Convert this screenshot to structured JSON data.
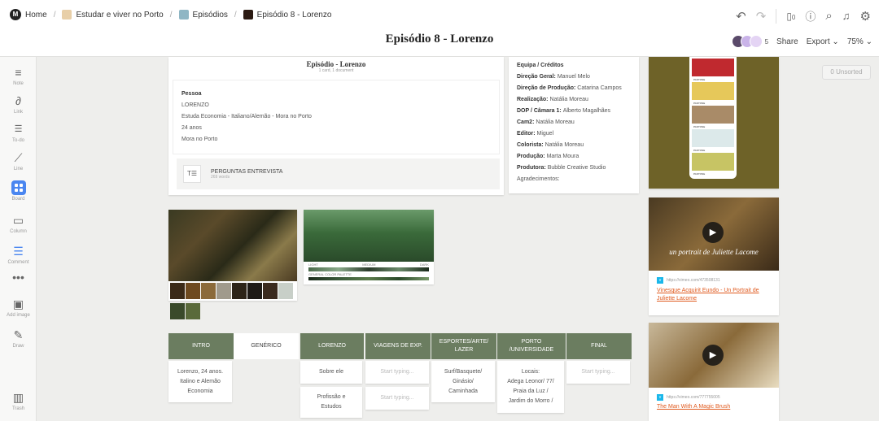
{
  "breadcrumbs": [
    {
      "label": "Home",
      "color": "#222222"
    },
    {
      "label": "Estudar e viver no Porto",
      "color": "#e8cfa8"
    },
    {
      "label": "Episódios",
      "color": "#8fb6c4"
    },
    {
      "label": "Episódio 8 - Lorenzo",
      "color": "#2b1a12"
    }
  ],
  "page_title": "Episódio 8 - Lorenzo",
  "toolbar": {
    "undo_icon": "undo-icon",
    "redo_icon": "redo-icon",
    "device_count": "0",
    "share_label": "Share",
    "export_label": "Export",
    "zoom_label": "75%",
    "avatar_count": "5"
  },
  "sidebar": [
    {
      "label": "Note",
      "icon": "note-icon"
    },
    {
      "label": "Link",
      "icon": "link-icon"
    },
    {
      "label": "To-do",
      "icon": "todo-icon"
    },
    {
      "label": "Line",
      "icon": "line-icon"
    },
    {
      "label": "Board",
      "icon": "board-icon"
    },
    {
      "label": "Column",
      "icon": "column-icon"
    },
    {
      "label": "Comment",
      "icon": "comment-icon"
    },
    {
      "label": "Add image",
      "icon": "image-icon"
    },
    {
      "label": "Draw",
      "icon": "draw-icon"
    },
    {
      "label": "Trash",
      "icon": "trash-icon"
    }
  ],
  "unsorted_label": "0 Unsorted",
  "board_card": {
    "title": "Episódio - Lorenzo",
    "meta": "1 card, 1 document",
    "note_lines": [
      "Pessoa",
      "LORENZO",
      "Estuda Economia - Italiano/Alemão - Mora no Porto",
      "24 anos",
      "Mora no Porto"
    ],
    "doc_title": "PERGUNTAS ENTREVISTA",
    "doc_meta": "269 words"
  },
  "credits": {
    "title": "Equipa / Créditos",
    "lines": [
      {
        "label": "Direção Geral:",
        "value": "Manuel Melo"
      },
      {
        "label": "Direção de Produção:",
        "value": "Catarina Campos"
      },
      {
        "label": "Realização:",
        "value": "Natália Moreau"
      },
      {
        "label": "DOP / Câmara 1:",
        "value": "Alberto Magalhães"
      },
      {
        "label": "Cam2:",
        "value": "Natália Moreau"
      },
      {
        "label": "Editor:",
        "value": "Miguel"
      },
      {
        "label": "Colorista:",
        "value": "Natália Moreau"
      },
      {
        "label": "Produção:",
        "value": "Marta Moura"
      },
      {
        "label": "Produtora:",
        "value": "Bubble Creative Studio"
      },
      {
        "label": "",
        "value": "Agradecimentos:"
      }
    ]
  },
  "palette_swatches": [
    "#3b2a18",
    "#6e4a20",
    "#8b6a3a",
    "#a09a8c",
    "#2d2418",
    "#1e1a16",
    "#3a2a1e",
    "#c8cfc8",
    "#3a4a2a",
    "#5a6a3a"
  ],
  "pantone_colors": [
    "#c0292f",
    "#e6c85a",
    "#a98b68",
    "#dce9ea",
    "#c7c464"
  ],
  "pantone_label": "PANTONE",
  "forest_palette_labels": [
    "LIGHT",
    "MEDIUM",
    "DARK",
    "GENERAL COLOR PALETTE"
  ],
  "video1": {
    "url": "https://vimeo.com/473508131",
    "title": "Vinesque Acquirit Eundo - Un Portrait de Juliette Lacome",
    "overlay": "un portrait de Juliette Lacome"
  },
  "video2": {
    "url": "https://vimeo.com/777755005",
    "title": "The Man With A Magic Brush"
  },
  "columns": [
    {
      "header": "INTRO",
      "cards": [
        "Lorenzo, 24 anos.\nItalino e Alemão\nEconomia"
      ]
    },
    {
      "header": "GENÉRICO",
      "cards": []
    },
    {
      "header": "LORENZO",
      "cards": [
        "Sobre ele",
        "Profissão e\nEstudos"
      ]
    },
    {
      "header": "VIAGENS DE EXP.",
      "cards": [
        "Start typing...",
        "Start typing..."
      ]
    },
    {
      "header": "ESPORTES/ARTE/\nLAZER",
      "cards": [
        "Surf/Basquete/\nGinásio/\nCaminhada"
      ]
    },
    {
      "header": "PORTO\n/UNIVERSIDADE",
      "cards": [
        "Locais:\nAdega Leonor/ 77/\nPraia da Luz /\nJardim do Morro /"
      ]
    },
    {
      "header": "FINAL",
      "cards": [
        "Start typing..."
      ]
    }
  ]
}
